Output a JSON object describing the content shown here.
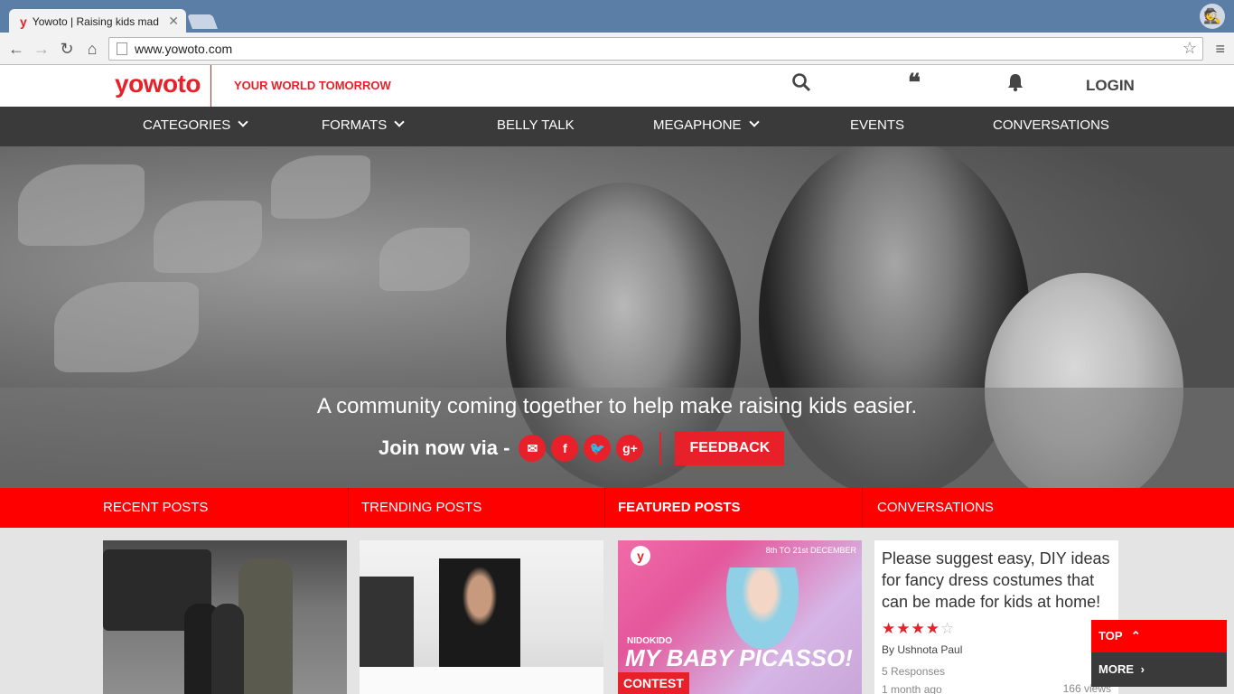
{
  "browser": {
    "tab_title": "Yowoto | Raising kids mad",
    "favicon": "y",
    "url": "www.yowoto.com"
  },
  "header": {
    "logo": "yowoto",
    "tagline": "YOUR WORLD TOMORROW",
    "login": "LOGIN"
  },
  "nav": {
    "categories": "CATEGORIES",
    "formats": "FORMATS",
    "belly_talk": "BELLY TALK",
    "megaphone": "MEGAPHONE",
    "events": "EVENTS",
    "conversations": "CONVERSATIONS"
  },
  "hero": {
    "headline": "A community coming together to help make raising kids easier.",
    "join": "Join now via -",
    "feedback": "FEEDBACK"
  },
  "tabs": {
    "recent": "RECENT POSTS",
    "trending": "TRENDING POSTS",
    "featured": "FEATURED POSTS",
    "conversations": "CONVERSATIONS"
  },
  "featured_card": {
    "brand": "NIDOKIDO",
    "title": "MY BABY PICASSO!",
    "badge": "CONTEST",
    "dates": "8th TO 21st DECEMBER"
  },
  "conversation": {
    "question": "Please suggest easy, DIY ideas for fancy dress costumes that can be made for kids at home!",
    "rating": 4,
    "rating_max": 5,
    "author": "By Ushnota Paul",
    "responses": "5 Responses",
    "time": "1 month ago",
    "views": "166 views"
  },
  "floating": {
    "top": "TOP",
    "more": "MORE"
  },
  "colors": {
    "brand_red": "#e8202a",
    "tab_red": "#ff0000",
    "nav_dark": "#3a3a3a"
  }
}
